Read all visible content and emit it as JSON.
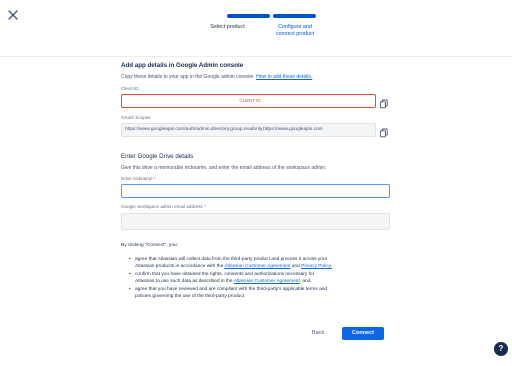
{
  "close_icon": "close-icon",
  "steps": [
    {
      "label_line1": "Select product",
      "label_line2": "",
      "state": "done"
    },
    {
      "label_line1": "Configure and",
      "label_line2": "connect product",
      "state": "active"
    }
  ],
  "admin_section": {
    "title": "Add app details in Google Admin console",
    "description": "Copy these details to your app in the Google admin console.",
    "how_to_link": "How to add these details.",
    "client_id_label": "Client ID",
    "client_id_value": "CLIENT ID",
    "oauth_label": "OAuth Scopes",
    "oauth_value": "https://www.googleapis.com/auth/admin.directory.group.readonly,https://www.googleapis.com",
    "copy_icon": "copy-icon"
  },
  "drive_section": {
    "title": "Enter Google Drive details",
    "description": "Give this drive a memorable nickname, and enter the email address of the workspace admin.",
    "nickname_label": "Drive nickname *",
    "nickname_value": "",
    "email_label": "Google workspace admin email address *",
    "email_value": ""
  },
  "consent": {
    "intro": "By clicking \"Connect\", you:",
    "bullet1_line1": "agree that Atlassian will collect data from the third-party product and process it across your",
    "bullet1_line2_prefix": "Atlassian products in accordance with the",
    "bullet1_link1": "Atlassian Customer Agreement",
    "bullet1_and": "and",
    "bullet1_link2": "Privacy Policy.",
    "bullet2_line1": "confirm that you have obtained the rights, consents and authorizations necessary for",
    "bullet2_line2_prefix": "Atlassian to use such data as described in the",
    "bullet2_link": "Atlassian Customer Agreement",
    "bullet2_suffix": ", and",
    "bullet3_line1": "agree that you have reviewed and are compliant with the third-party's applicable terms and",
    "bullet3_line2": "policies governing the use of the third-party product."
  },
  "footer": {
    "back_label": "Back",
    "connect_label": "Connect",
    "help_label": "?"
  },
  "colors": {
    "brand": "#0052cc",
    "primary_button": "#0c66e4",
    "error": "#e34935",
    "focus": "#4c9aff"
  }
}
